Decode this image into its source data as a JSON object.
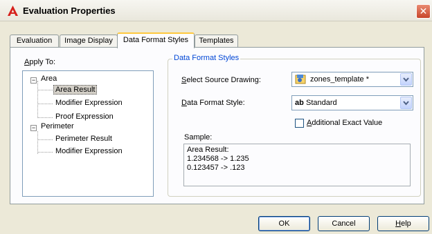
{
  "window": {
    "title": "Evaluation Properties",
    "app_icon": "autocad-icon",
    "close_glyph": "✕"
  },
  "tabs": [
    {
      "label": "Evaluation",
      "active": false
    },
    {
      "label": "Image Display",
      "active": false
    },
    {
      "label": "Data Format Styles",
      "active": true
    },
    {
      "label": "Templates",
      "active": false
    }
  ],
  "apply_to": {
    "label_first": "A",
    "label_rest": "pply To:",
    "tree": {
      "area": {
        "label": "Area",
        "expander": "−",
        "children": [
          "Area Result",
          "Modifier Expression",
          "Proof Expression"
        ]
      },
      "perimeter": {
        "label": "Perimeter",
        "expander": "−",
        "children": [
          "Perimeter Result",
          "Modifier Expression"
        ]
      },
      "selected": "Area Result"
    }
  },
  "data_format_styles": {
    "group_title": "Data Format Styles",
    "source_drawing": {
      "label_first": "S",
      "label_rest": "elect Source Drawing:",
      "value": "zones_template *",
      "icon": "drawing-file-icon"
    },
    "format_style": {
      "label_first": "D",
      "label_rest": "ata Format Style:",
      "icon_text": "ab",
      "value": "Standard"
    },
    "additional_exact": {
      "label_first": "A",
      "label_rest": "dditional Exact Value",
      "checked": false
    },
    "sample": {
      "label": "Sample:",
      "lines": [
        "Area Result:",
        "1.234568 -> 1.235",
        "0.123457 -> .123"
      ]
    }
  },
  "buttons": {
    "ok": "OK",
    "cancel": "Cancel",
    "help_first": "H",
    "help_rest": "elp"
  },
  "colors": {
    "group_title": "#0046d5",
    "active_tab_highlight": "#ffc83c",
    "close_button": "#c8452a"
  }
}
